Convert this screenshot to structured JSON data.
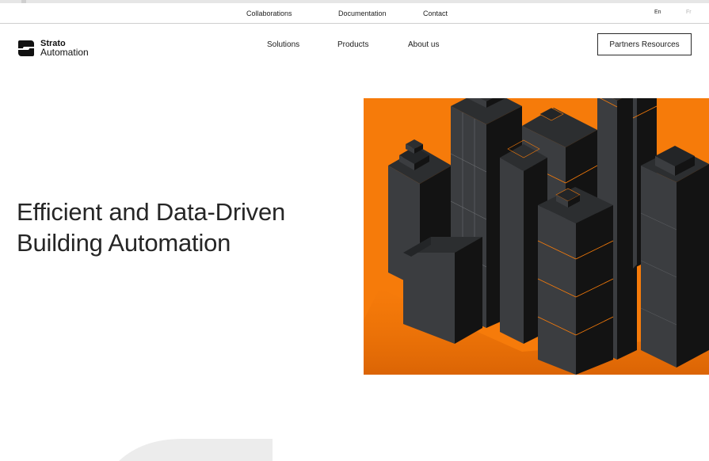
{
  "utility_nav": {
    "items": [
      {
        "label": "Collaborations"
      },
      {
        "label": "Documentation"
      },
      {
        "label": "Contact"
      }
    ],
    "languages": {
      "active": "En",
      "inactive": "Fr"
    }
  },
  "brand": {
    "logo_icon": "strato-logo-icon",
    "name_line1": "Strato",
    "name_line2": "Automation"
  },
  "main_nav": {
    "items": [
      {
        "label": "Solutions"
      },
      {
        "label": "Products"
      },
      {
        "label": "About us"
      }
    ],
    "cta_label": "Partners Resources"
  },
  "hero": {
    "title_line1": "Efficient and Data-Driven",
    "title_line2": "Building Automation",
    "illustration": "isometric-buildings-illustration"
  },
  "colors": {
    "accent": "#f67b0a",
    "building_face_light": "#3a3c3e",
    "building_face_dark": "#141414",
    "building_top": "#2a2c2e",
    "text": "#262626"
  }
}
